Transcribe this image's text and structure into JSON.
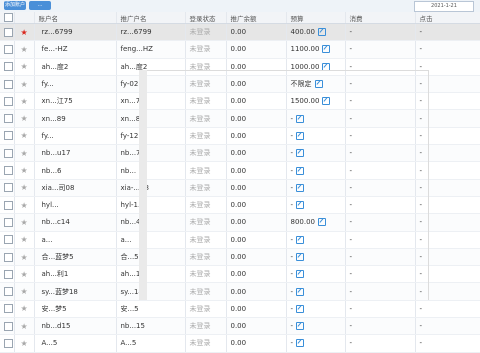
{
  "toolbar": {
    "btn1": "添加账户",
    "btn2": "...",
    "date": "2021-1-21"
  },
  "columns": [
    "账户名",
    "推广户名",
    "登录状态",
    "推广余额",
    "预算",
    "消费",
    "点击"
  ],
  "rows": [
    {
      "name": "rz...6799",
      "alias": "rz...6799",
      "status": "未登录",
      "balance": "0.00",
      "budget": "400.00",
      "edit": true,
      "spend": "-",
      "clicks": "-",
      "red": true,
      "sel": true
    },
    {
      "name": "fe...-HZ",
      "alias": "feng...HZ",
      "status": "未登录",
      "balance": "0.00",
      "budget": "1100.00",
      "edit": true,
      "spend": "-",
      "clicks": "-"
    },
    {
      "name": "ah...度2",
      "alias": "ah...度2",
      "status": "未登录",
      "balance": "0.00",
      "budget": "1000.00",
      "edit": true,
      "spend": "-",
      "clicks": "-"
    },
    {
      "name": "fy...",
      "alias": "fy-02",
      "status": "未登录",
      "balance": "0.00",
      "budget": "不限定",
      "edit": true,
      "spend": "-",
      "clicks": "-"
    },
    {
      "name": "xn...江75",
      "alias": "xn...75",
      "status": "未登录",
      "balance": "0.00",
      "budget": "1500.00",
      "edit": true,
      "spend": "-",
      "clicks": "-"
    },
    {
      "name": "xn...89",
      "alias": "xn...89",
      "status": "未登录",
      "balance": "0.00",
      "budget": "-",
      "edit": true,
      "spend": "-",
      "clicks": "-"
    },
    {
      "name": "fy...",
      "alias": "fy-12",
      "status": "未登录",
      "balance": "0.00",
      "budget": "-",
      "edit": true,
      "spend": "-",
      "clicks": "-"
    },
    {
      "name": "nb...u17",
      "alias": "nb...7",
      "status": "未登录",
      "balance": "0.00",
      "budget": "-",
      "edit": true,
      "spend": "-",
      "clicks": "-"
    },
    {
      "name": "nb...6",
      "alias": "nb...",
      "status": "未登录",
      "balance": "0.00",
      "budget": "-",
      "edit": true,
      "spend": "-",
      "clicks": "-"
    },
    {
      "name": "xia...司08",
      "alias": "xia-...08",
      "status": "未登录",
      "balance": "0.00",
      "budget": "-",
      "edit": true,
      "spend": "-",
      "clicks": "-"
    },
    {
      "name": "hyl...",
      "alias": "hyl-1...",
      "status": "未登录",
      "balance": "0.00",
      "budget": "-",
      "edit": true,
      "spend": "-",
      "clicks": "-"
    },
    {
      "name": "nb...c14",
      "alias": "nb...4",
      "status": "未登录",
      "balance": "0.00",
      "budget": "800.00",
      "edit": true,
      "spend": "-",
      "clicks": "-"
    },
    {
      "name": "a...",
      "alias": "a...",
      "status": "未登录",
      "balance": "0.00",
      "budget": "-",
      "edit": true,
      "spend": "-",
      "clicks": "-"
    },
    {
      "name": "合...蓝梦5",
      "alias": "合...5",
      "status": "未登录",
      "balance": "0.00",
      "budget": "-",
      "edit": true,
      "spend": "-",
      "clicks": "-"
    },
    {
      "name": "ah...利1",
      "alias": "ah...1",
      "status": "未登录",
      "balance": "0.00",
      "budget": "-",
      "edit": true,
      "spend": "-",
      "clicks": "-"
    },
    {
      "name": "sy...蓝梦18",
      "alias": "sy...18",
      "status": "未登录",
      "balance": "0.00",
      "budget": "-",
      "edit": true,
      "spend": "-",
      "clicks": "-"
    },
    {
      "name": "安...梦5",
      "alias": "安...5",
      "status": "未登录",
      "balance": "0.00",
      "budget": "-",
      "edit": true,
      "spend": "-",
      "clicks": "-"
    },
    {
      "name": "nb...d15",
      "alias": "nb...15",
      "status": "未登录",
      "balance": "0.00",
      "budget": "-",
      "edit": true,
      "spend": "-",
      "clicks": "-"
    },
    {
      "name": "A...5",
      "alias": "A...5",
      "status": "未登录",
      "balance": "0.00",
      "budget": "-",
      "edit": true,
      "spend": "-",
      "clicks": "-"
    }
  ]
}
